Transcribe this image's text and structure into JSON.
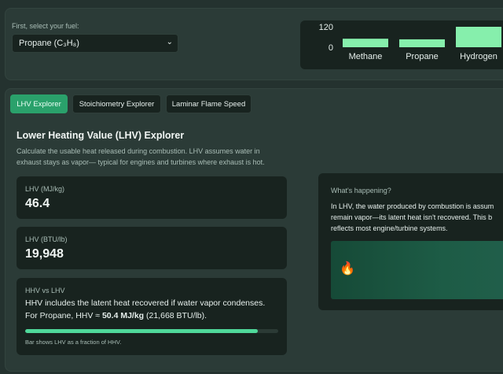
{
  "fuel": {
    "label": "First, select your fuel:",
    "selected": "Propane (C₃H₈)"
  },
  "chart_data": {
    "type": "bar",
    "categories": [
      "Methane",
      "Propane",
      "Hydrogen"
    ],
    "values": [
      50,
      46.4,
      120
    ],
    "yticks": [
      0,
      120
    ],
    "ylim": [
      0,
      120
    ],
    "bar_color": "#86efac"
  },
  "tabs": [
    {
      "label": "LHV Explorer",
      "active": true
    },
    {
      "label": "Stoichiometry Explorer",
      "active": false
    },
    {
      "label": "Laminar Flame Speed",
      "active": false
    }
  ],
  "section": {
    "title": "Lower Heating Value (LHV) Explorer",
    "description": "Calculate the usable heat released during combustion. LHV assumes water in exhaust stays as vapor— typical for engines and turbines where exhaust is hot."
  },
  "lhv_mj": {
    "label": "LHV (MJ/kg)",
    "value": "46.4"
  },
  "lhv_btu": {
    "label": "LHV (BTU/lb)",
    "value": "19,948"
  },
  "hhv": {
    "label": "HHV vs LHV",
    "line1": "HHV includes the latent heat recovered if water vapor condenses.",
    "line2_prefix": "For Propane, HHV ≈ ",
    "line2_strong": "50.4 MJ/kg",
    "line2_suffix": " (21,668 BTU/lb).",
    "bar_fraction": 0.92,
    "bar_note": "Bar shows LHV as a fraction of HHV."
  },
  "info": {
    "title": "What's happening?",
    "line1": "In LHV, the water produced by combustion is assum",
    "line2": "remain vapor—its latent heat isn't recovered. This b",
    "line3": "reflects most engine/turbine systems.",
    "icon": "fire-icon"
  },
  "colors": {
    "accent": "#2aa16b",
    "bar": "#4fd89a"
  }
}
